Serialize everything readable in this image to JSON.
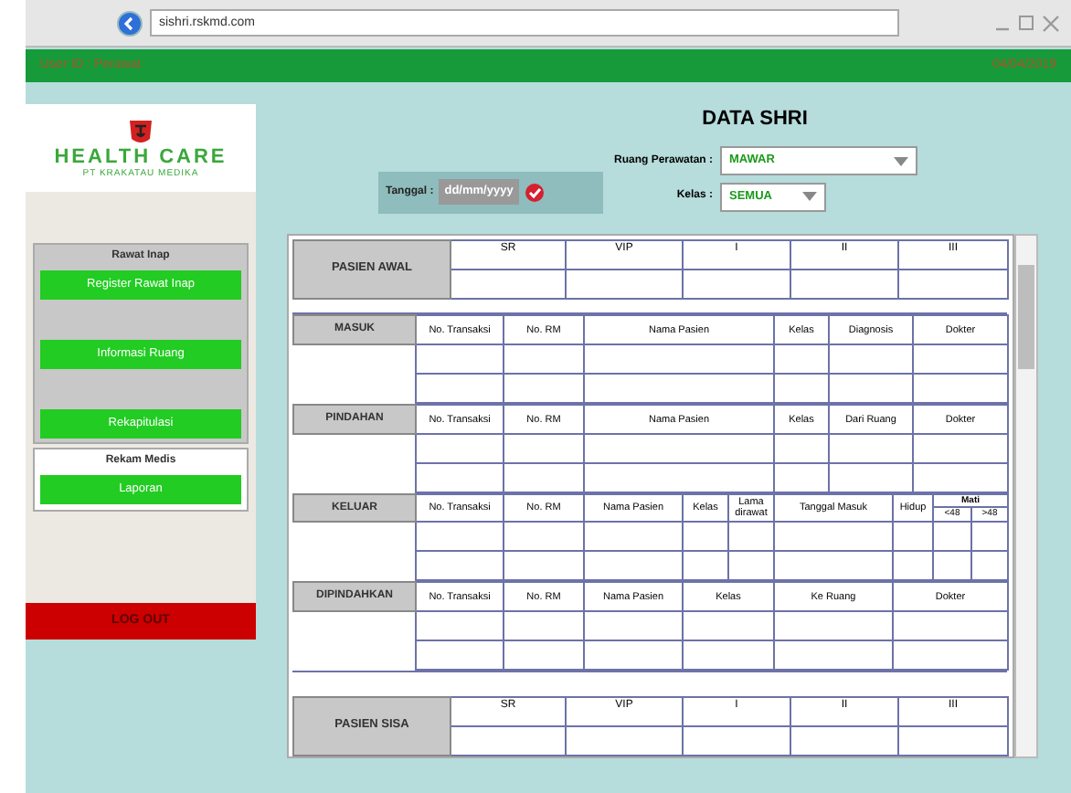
{
  "browser": {
    "url": "sishri.rskmd.com"
  },
  "header": {
    "user": "User ID : Perawat",
    "date": "04/04/2019"
  },
  "sidebar": {
    "logo": {
      "name": "HEALTH CARE",
      "subtitle": "PT KRAKATAU MEDIKA"
    },
    "groups": [
      {
        "title": "Rawat Inap",
        "items": [
          "Register Rawat Inap",
          "Informasi Ruang",
          "Rekapitulasi"
        ]
      },
      {
        "title": "Rekam Medis",
        "items": [
          "Laporan"
        ]
      }
    ],
    "logout": "LOG OUT"
  },
  "title": "DATA SHRI",
  "filters": {
    "date": {
      "label": "Tanggal :",
      "placeholder": "dd/mm/yyyy"
    },
    "room": {
      "label": "Ruang Perawatan :",
      "value": "MAWAR"
    },
    "class": {
      "label": "Kelas :",
      "value": "SEMUA"
    }
  },
  "blocks": [
    {
      "kind": "summary",
      "label": "PASIEN AWAL",
      "columns": [
        {
          "label": "SR"
        },
        {
          "label": "VIP"
        },
        {
          "label": "I"
        },
        {
          "label": "II"
        },
        {
          "label": "III"
        }
      ]
    },
    {
      "kind": "detail",
      "label": "MASUK",
      "columns": [
        {
          "label": "No. Transaksi"
        },
        {
          "label": "No. RM"
        },
        {
          "label": "Nama Pasien"
        },
        {
          "label": "Kelas"
        },
        {
          "label": "Diagnosis"
        },
        {
          "label": "Dokter"
        }
      ]
    },
    {
      "kind": "detail",
      "label": "PINDAHAN",
      "columns": [
        {
          "label": "No. Transaksi"
        },
        {
          "label": "No. RM"
        },
        {
          "label": "Nama Pasien"
        },
        {
          "label": "Kelas"
        },
        {
          "label": "Dari Ruang"
        },
        {
          "label": "Dokter"
        }
      ]
    },
    {
      "kind": "detail",
      "label": "KELUAR",
      "columns": [
        {
          "label": "No. Transaksi"
        },
        {
          "label": "No. RM"
        },
        {
          "label": "Nama Pasien"
        },
        {
          "label": "Kelas"
        },
        {
          "label": "Lama dirawat"
        },
        {
          "label": "Tanggal Masuk"
        },
        {
          "label": "Hidup"
        },
        {
          "label": "Mati",
          "children": [
            "<48",
            ">48"
          ]
        }
      ]
    },
    {
      "kind": "detail",
      "label": "DIPINDAHKAN",
      "columns": [
        {
          "label": "No. Transaksi"
        },
        {
          "label": "No. RM"
        },
        {
          "label": "Nama Pasien"
        },
        {
          "label": "Kelas"
        },
        {
          "label": "Ke Ruang"
        },
        {
          "label": "Dokter"
        }
      ]
    },
    {
      "kind": "summary",
      "label": "PASIEN SISA",
      "columns": [
        {
          "label": "SR"
        },
        {
          "label": "VIP"
        },
        {
          "label": "I"
        },
        {
          "label": "II"
        },
        {
          "label": "III"
        }
      ]
    }
  ]
}
